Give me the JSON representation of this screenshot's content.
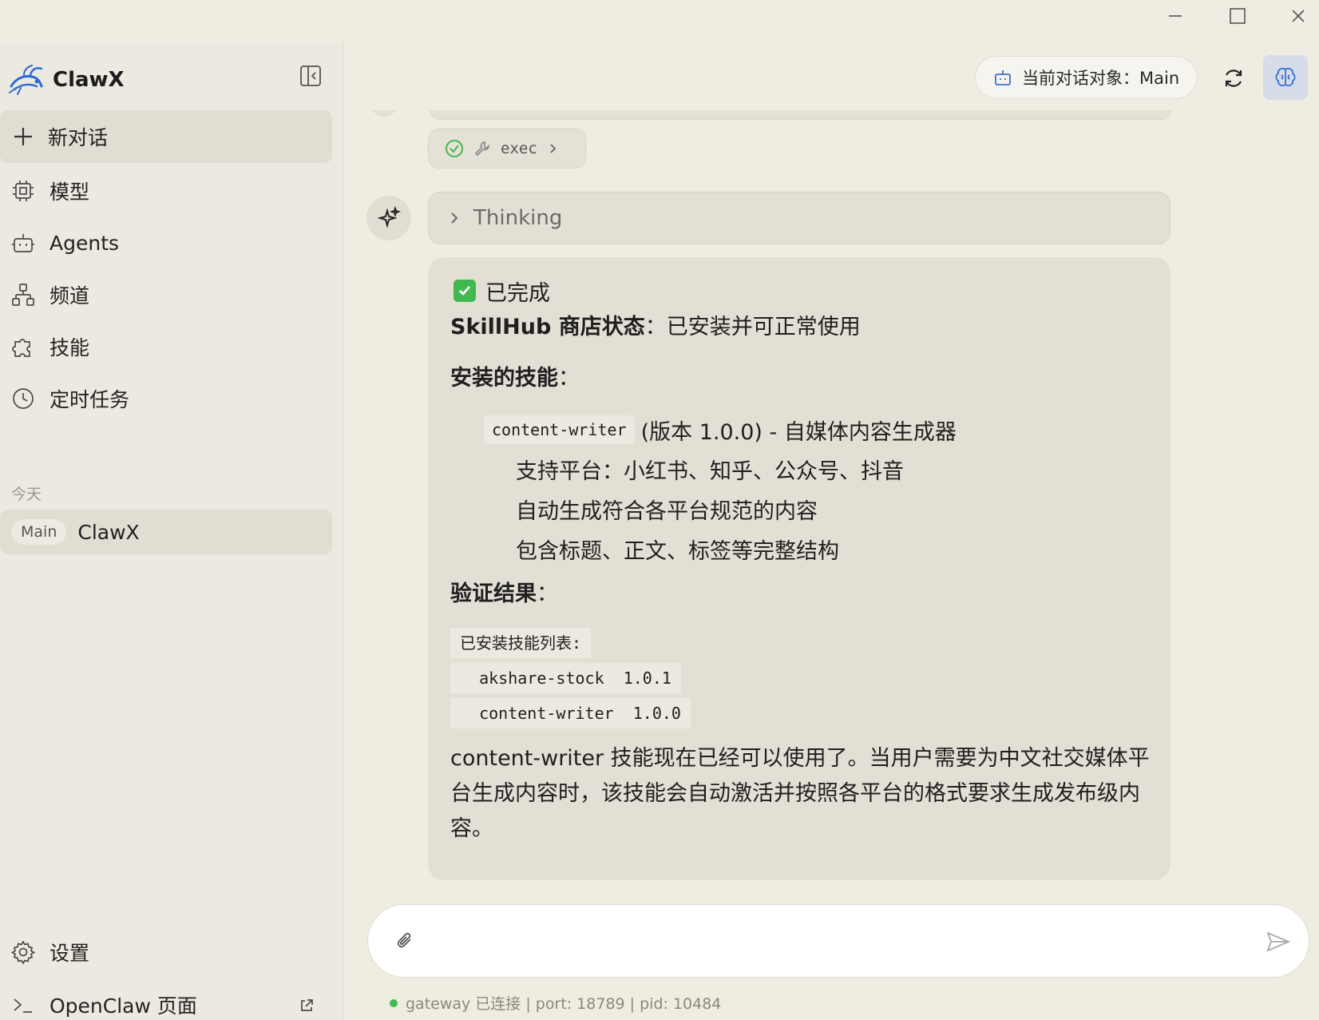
{
  "window": {
    "minimize_icon": "minimize-icon",
    "maximize_icon": "maximize-icon",
    "close_icon": "close-icon"
  },
  "sidebar": {
    "app_name": "ClawX",
    "new_chat_label": "新对话",
    "nav": [
      {
        "label": "模型",
        "icon": "chip-icon"
      },
      {
        "label": "Agents",
        "icon": "robot-icon"
      },
      {
        "label": "频道",
        "icon": "network-icon"
      },
      {
        "label": "技能",
        "icon": "puzzle-icon"
      },
      {
        "label": "定时任务",
        "icon": "clock-icon"
      }
    ],
    "section_today": "今天",
    "sessions": [
      {
        "badge": "Main",
        "title": "ClawX"
      }
    ],
    "footer": [
      {
        "label": "设置",
        "icon": "gear-icon"
      },
      {
        "label": "OpenClaw 页面",
        "icon": "terminal-icon"
      }
    ]
  },
  "header": {
    "agent_label": "当前对话对象：Main"
  },
  "chat": {
    "tool_name": "exec",
    "thinking_label": "Thinking",
    "message": {
      "done": "已完成",
      "status_bold": "SkillHub 商店状态",
      "status_rest": "：已安装并可正常使用",
      "installed_heading": "安装的技能",
      "colon": "：",
      "skill_code": "content-writer",
      "skill_desc": "(版本 1.0.0) - 自媒体内容生成器",
      "bullets": [
        "支持平台：小红书、知乎、公众号、抖音",
        "自动生成符合各平台规范的内容",
        "包含标题、正文、标签等完整结构"
      ],
      "verify_heading": "验证结果",
      "code_lines": [
        "已安装技能列表:",
        "  akshare-stock  1.0.1",
        "  content-writer  1.0.0"
      ],
      "summary": "content-writer 技能现在已经可以使用了。当用户需要为中文社交媒体平台生成内容时，该技能会自动激活并按照各平台的格式要求生成发布级内容。"
    }
  },
  "composer": {
    "placeholder": ""
  },
  "status": {
    "text": "gateway 已连接 | port: 18789 | pid: 10484",
    "dot_color": "#3fb950"
  },
  "colors": {
    "accent": "#2f6ad3",
    "success": "#3fb950"
  }
}
